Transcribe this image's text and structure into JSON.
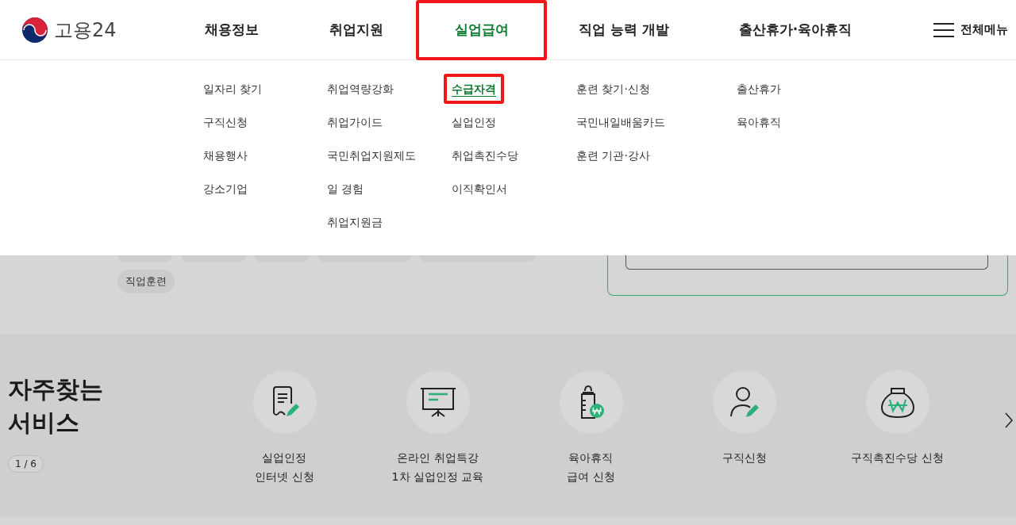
{
  "logo": {
    "text": "고용24"
  },
  "nav": [
    {
      "label": "채용정보",
      "selected": false
    },
    {
      "label": "취업지원",
      "selected": false
    },
    {
      "label": "실업급여",
      "selected": true
    },
    {
      "label": "직업 능력 개발",
      "selected": false
    },
    {
      "label": "출산휴가·육아휴직",
      "selected": false
    }
  ],
  "all_menu": {
    "label": "전체메뉴"
  },
  "submenu": [
    {
      "items": [
        {
          "label": "일자리 찾기",
          "selected": false
        },
        {
          "label": "구직신청",
          "selected": false
        },
        {
          "label": "채용행사",
          "selected": false
        },
        {
          "label": "강소기업",
          "selected": false
        }
      ]
    },
    {
      "items": [
        {
          "label": "취업역량강화",
          "selected": false
        },
        {
          "label": "취업가이드",
          "selected": false
        },
        {
          "label": "국민취업지원제도",
          "selected": false
        },
        {
          "label": "일 경험",
          "selected": false
        },
        {
          "label": "취업지원금",
          "selected": false
        }
      ]
    },
    {
      "items": [
        {
          "label": "수급자격",
          "selected": true
        },
        {
          "label": "실업인정",
          "selected": false
        },
        {
          "label": "취업촉진수당",
          "selected": false
        },
        {
          "label": "이직확인서",
          "selected": false
        }
      ]
    },
    {
      "items": [
        {
          "label": "훈련 찾기·신청",
          "selected": false
        },
        {
          "label": "국민내일배움카드",
          "selected": false
        },
        {
          "label": "훈련 기관·강사",
          "selected": false
        }
      ]
    },
    {
      "items": [
        {
          "label": "출산휴가",
          "selected": false
        },
        {
          "label": "육아휴직",
          "selected": false
        }
      ]
    }
  ],
  "tags": [
    {
      "label": "직업훈련"
    }
  ],
  "services": {
    "title": [
      "자주찾는",
      "서비스"
    ],
    "counter": "1 / 6",
    "items": [
      {
        "kind": "document",
        "lines": [
          "실업인정",
          "인터넷 신청"
        ]
      },
      {
        "kind": "presentation",
        "lines": [
          "온라인 취업특강",
          "1차 실업인정 교육"
        ]
      },
      {
        "kind": "bottle",
        "lines": [
          "육아휴직",
          "급여 신청"
        ]
      },
      {
        "kind": "person",
        "lines": [
          "구직신청"
        ]
      },
      {
        "kind": "moneybag",
        "lines": [
          "구직촉진수당 신청"
        ]
      }
    ]
  }
}
